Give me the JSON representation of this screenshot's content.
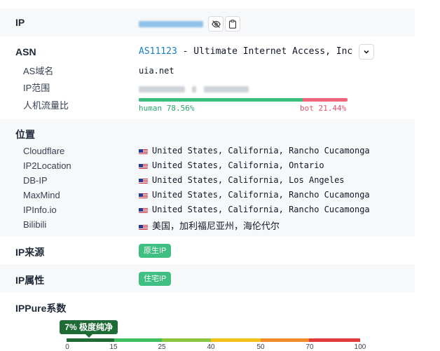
{
  "ip": {
    "label": "IP"
  },
  "asn": {
    "label": "ASN",
    "number": "AS11123",
    "org": " - Ultimate Internet Access, Inc",
    "domain_label": "AS域名",
    "domain_value": "uia.net",
    "range_label": "IP范围",
    "ratio_label": "人机流量比",
    "human_text": "human 78.56%",
    "bot_text": "bot 21.44%",
    "human_pct": 78.56
  },
  "location": {
    "label": "位置",
    "entries": [
      {
        "source": "Cloudflare",
        "place": "United States, California, Rancho Cucamonga"
      },
      {
        "source": "IP2Location",
        "place": "United States, California, Ontario"
      },
      {
        "source": "DB-IP",
        "place": "United States, California, Los Angeles"
      },
      {
        "source": "MaxMind",
        "place": "United States, California, Rancho Cucamonga"
      },
      {
        "source": "IPInfo.io",
        "place": "United States, California, Rancho Cucamonga"
      },
      {
        "source": "Bilibili",
        "place": "美国，加利福尼亚州，海伦代尔"
      }
    ]
  },
  "source": {
    "label": "IP来源",
    "tag": "原生IP"
  },
  "attr": {
    "label": "IP属性",
    "tag": "住宅IP"
  },
  "purity": {
    "label": "IPPure系数",
    "badge": "7% 极度纯净",
    "value": 7,
    "ticks": [
      "0",
      "15",
      "25",
      "40",
      "50",
      "70",
      "100"
    ]
  },
  "colors": {
    "accent": "#1a7fc1",
    "human": "#3cbf7e",
    "bot": "#f0657a",
    "badge": "#1f6b35"
  }
}
